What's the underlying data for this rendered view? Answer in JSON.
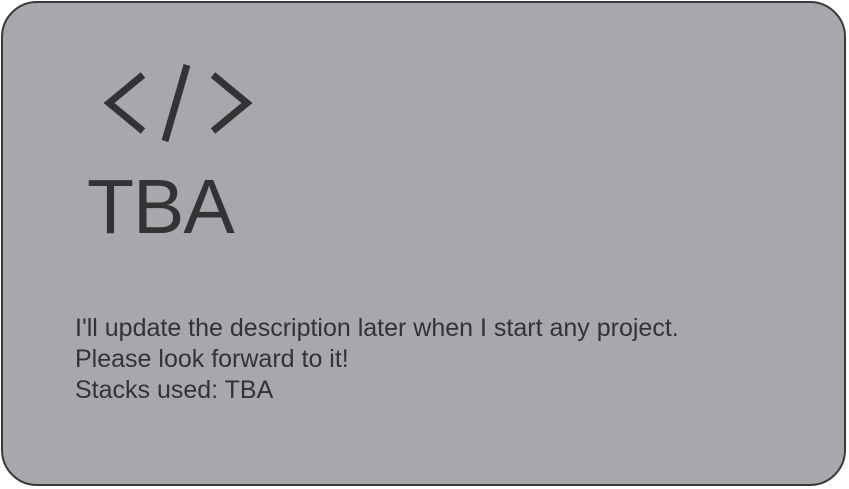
{
  "card": {
    "icon": "code-icon",
    "title": "TBA",
    "description_lines": [
      "I'll update the description later when I start any project.",
      "Please look forward to it!",
      "Stacks used: TBA"
    ]
  },
  "colors": {
    "card_background": "#a7a8ab",
    "card_border": "#3a3a3c",
    "text": "#333335"
  }
}
